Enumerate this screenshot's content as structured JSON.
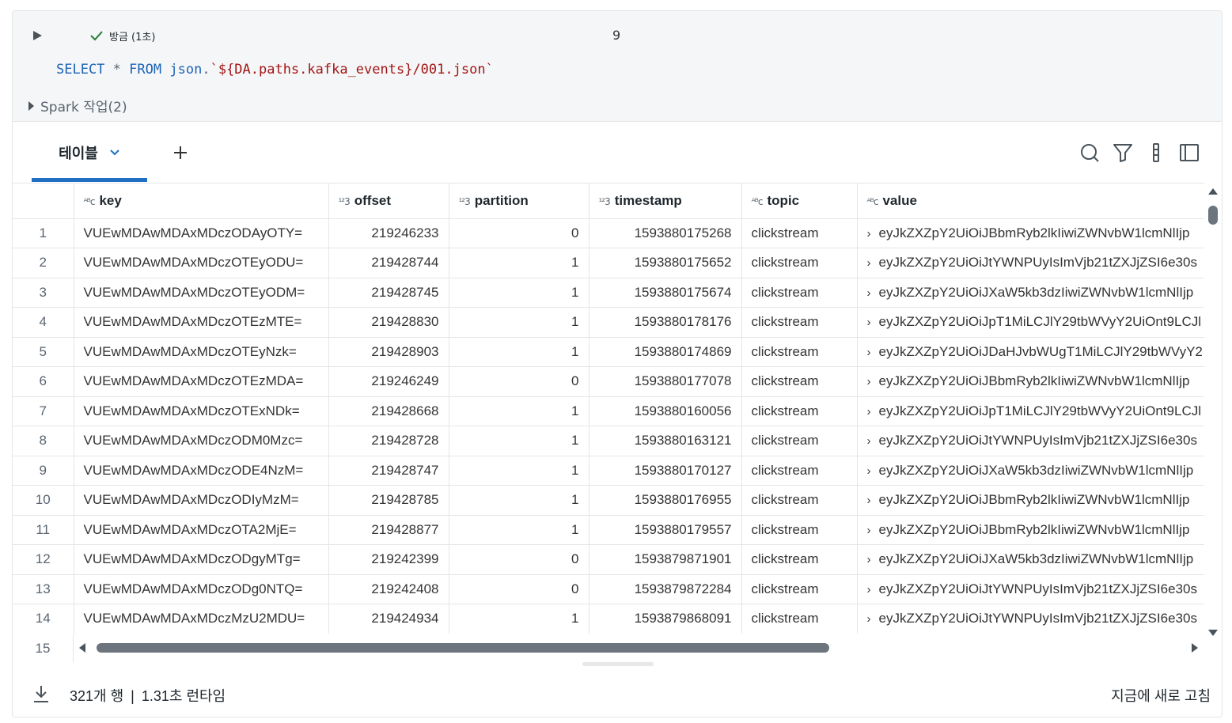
{
  "cell": {
    "status_text": "방금 (1초)",
    "cell_number": "9",
    "code": {
      "select": "SELECT",
      "star": "*",
      "from": "FROM",
      "json": "json",
      "dot": ".",
      "path": "`${DA.paths.kafka_events}/001.json`"
    },
    "spark_jobs": "Spark 작업(2)"
  },
  "tabs": {
    "active_label": "테이블"
  },
  "icons": [
    "play-icon",
    "check-icon",
    "chevron-down-icon",
    "plus-icon",
    "search-icon",
    "filter-icon",
    "column-settings-icon",
    "sidebar-panel-icon",
    "download-icon",
    "expand-chevron-icon"
  ],
  "table": {
    "columns": [
      {
        "type": "ABC",
        "label": "key"
      },
      {
        "type": "123",
        "label": "offset"
      },
      {
        "type": "123",
        "label": "partition"
      },
      {
        "type": "123",
        "label": "timestamp"
      },
      {
        "type": "ABC",
        "label": "topic"
      },
      {
        "type": "ABC",
        "label": "value"
      }
    ],
    "rows": [
      {
        "n": "1",
        "key": "VUEwMDAwMDAxMDczODAyOTY=",
        "offset": "219246233",
        "partition": "0",
        "timestamp": "1593880175268",
        "topic": "clickstream",
        "value": "eyJkZXZpY2UiOiJBbmRyb2lkIiwiZWNvbW1lcmNlIjp"
      },
      {
        "n": "2",
        "key": "VUEwMDAwMDAxMDczOTEyODU=",
        "offset": "219428744",
        "partition": "1",
        "timestamp": "1593880175652",
        "topic": "clickstream",
        "value": "eyJkZXZpY2UiOiJtYWNPUyIsImVjb21tZXJjZSI6e30s"
      },
      {
        "n": "3",
        "key": "VUEwMDAwMDAxMDczOTEyODM=",
        "offset": "219428745",
        "partition": "1",
        "timestamp": "1593880175674",
        "topic": "clickstream",
        "value": "eyJkZXZpY2UiOiJXaW5kb3dzIiwiZWNvbW1lcmNlIjp"
      },
      {
        "n": "4",
        "key": "VUEwMDAwMDAxMDczOTEzMTE=",
        "offset": "219428830",
        "partition": "1",
        "timestamp": "1593880178176",
        "topic": "clickstream",
        "value": "eyJkZXZpY2UiOiJpT1MiLCJlY29tbWVyY2UiOnt9LCJl"
      },
      {
        "n": "5",
        "key": "VUEwMDAwMDAxMDczOTEyNzk=",
        "offset": "219428903",
        "partition": "1",
        "timestamp": "1593880174869",
        "topic": "clickstream",
        "value": "eyJkZXZpY2UiOiJDaHJvbWUgT1MiLCJlY29tbWVyY2"
      },
      {
        "n": "6",
        "key": "VUEwMDAwMDAxMDczOTEzMDA=",
        "offset": "219246249",
        "partition": "0",
        "timestamp": "1593880177078",
        "topic": "clickstream",
        "value": "eyJkZXZpY2UiOiJBbmRyb2lkIiwiZWNvbW1lcmNlIjp"
      },
      {
        "n": "7",
        "key": "VUEwMDAwMDAxMDczOTExNDk=",
        "offset": "219428668",
        "partition": "1",
        "timestamp": "1593880160056",
        "topic": "clickstream",
        "value": "eyJkZXZpY2UiOiJpT1MiLCJlY29tbWVyY2UiOnt9LCJl"
      },
      {
        "n": "8",
        "key": "VUEwMDAwMDAxMDczODM0Mzc=",
        "offset": "219428728",
        "partition": "1",
        "timestamp": "1593880163121",
        "topic": "clickstream",
        "value": "eyJkZXZpY2UiOiJtYWNPUyIsImVjb21tZXJjZSI6e30s"
      },
      {
        "n": "9",
        "key": "VUEwMDAwMDAxMDczODE4NzM=",
        "offset": "219428747",
        "partition": "1",
        "timestamp": "1593880170127",
        "topic": "clickstream",
        "value": "eyJkZXZpY2UiOiJXaW5kb3dzIiwiZWNvbW1lcmNlIjp"
      },
      {
        "n": "10",
        "key": "VUEwMDAwMDAxMDczODIyMzM=",
        "offset": "219428785",
        "partition": "1",
        "timestamp": "1593880176955",
        "topic": "clickstream",
        "value": "eyJkZXZpY2UiOiJBbmRyb2lkIiwiZWNvbW1lcmNlIjp"
      },
      {
        "n": "11",
        "key": "VUEwMDAwMDAxMDczOTA2MjE=",
        "offset": "219428877",
        "partition": "1",
        "timestamp": "1593880179557",
        "topic": "clickstream",
        "value": "eyJkZXZpY2UiOiJBbmRyb2lkIiwiZWNvbW1lcmNlIjp"
      },
      {
        "n": "12",
        "key": "VUEwMDAwMDAxMDczODgyMTg=",
        "offset": "219242399",
        "partition": "0",
        "timestamp": "1593879871901",
        "topic": "clickstream",
        "value": "eyJkZXZpY2UiOiJXaW5kb3dzIiwiZWNvbW1lcmNlIjp"
      },
      {
        "n": "13",
        "key": "VUEwMDAwMDAxMDczODg0NTQ=",
        "offset": "219242408",
        "partition": "0",
        "timestamp": "1593879872284",
        "topic": "clickstream",
        "value": "eyJkZXZpY2UiOiJtYWNPUyIsImVjb21tZXJjZSI6e30s"
      },
      {
        "n": "14",
        "key": "VUEwMDAwMDAxMDczMzU2MDU=",
        "offset": "219424934",
        "partition": "1",
        "timestamp": "1593879868091",
        "topic": "clickstream",
        "value": "eyJkZXZpY2UiOiJtYWNPUyIsImVjb21tZXJjZSI6e30s"
      }
    ],
    "partial_row_number": "15"
  },
  "footer": {
    "row_count": "321개 행",
    "separator": "|",
    "runtime": "1.31초 런타임",
    "refresh": "지금에 새로 고침"
  }
}
